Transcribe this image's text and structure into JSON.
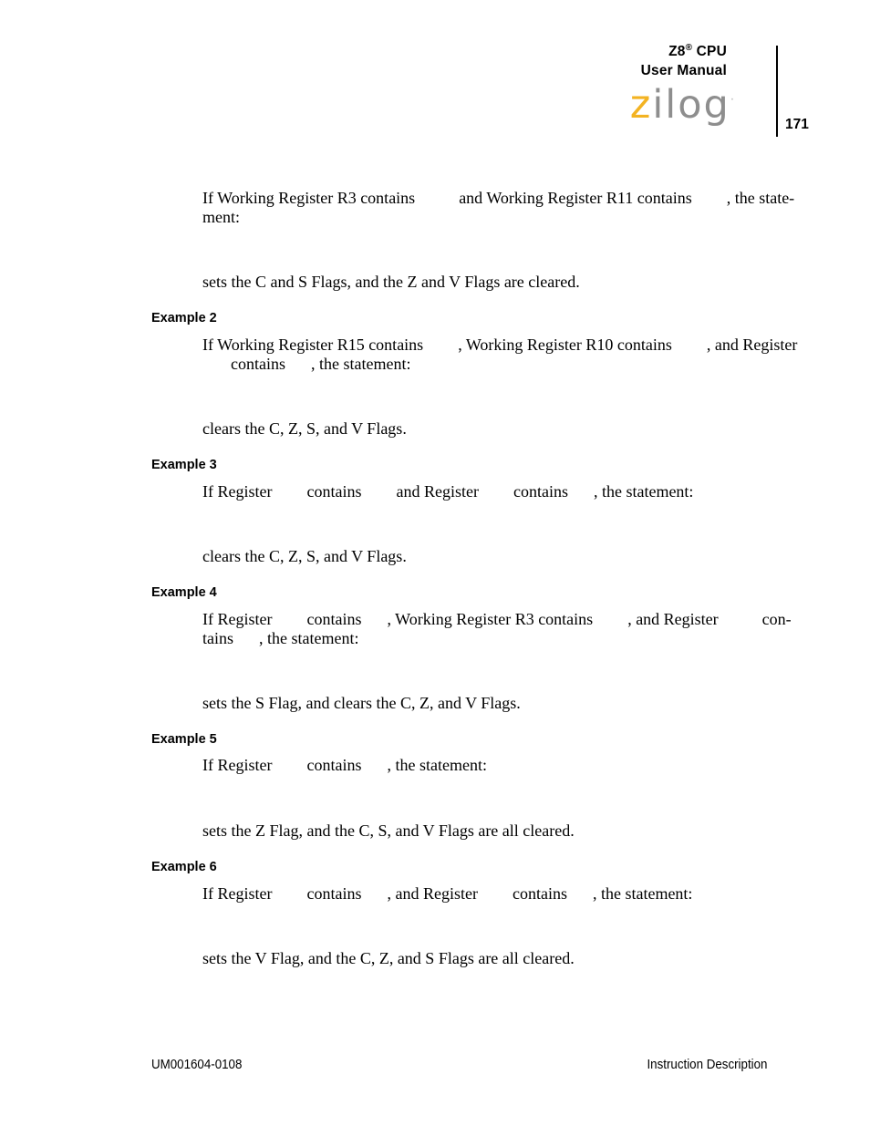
{
  "header": {
    "product_line1_main": "Z8",
    "product_line1_sup": "®",
    "product_line1_tail": " CPU",
    "product_line2": "User Manual",
    "logo_z": "z",
    "logo_ilog": "ilog",
    "logo_reg": "·",
    "page_number": "171",
    "accent_color": "#f3b322",
    "logo_gray": "#8e8e8e"
  },
  "body": {
    "example1": {
      "condition_line1_a": "If Working Register R3 contains",
      "condition_line1_b": "and Working Register R11 contains",
      "condition_line1_c": ", the state-",
      "condition_line2": "ment:",
      "statement": "",
      "result": "sets the C and S Flags, and the Z and V Flags are cleared."
    },
    "example2": {
      "heading": "Example 2",
      "condition_line1_a": "If Working Register R15 contains",
      "condition_line1_b": ", Working Register R10 contains",
      "condition_line1_c": ", and Register",
      "condition_line2_a": "contains",
      "condition_line2_b": ", the statement:",
      "statement": "",
      "result": "clears the C, Z, S, and V Flags."
    },
    "example3": {
      "heading": "Example 3",
      "condition_a": "If Register",
      "condition_b": "contains",
      "condition_c": "and Register",
      "condition_d": "contains",
      "condition_e": ", the statement:",
      "statement": "",
      "result": "clears the C, Z, S, and V Flags."
    },
    "example4": {
      "heading": "Example 4",
      "condition_line1_a": "If Register",
      "condition_line1_b": "contains",
      "condition_line1_c": ", Working Register R3 contains",
      "condition_line1_d": ", and Register",
      "condition_line1_e": "con-",
      "condition_line2_a": "tains",
      "condition_line2_b": ", the statement:",
      "statement": "",
      "result": "sets the S Flag, and clears the C, Z, and V Flags."
    },
    "example5": {
      "heading": "Example 5",
      "condition_a": "If Register",
      "condition_b": "contains",
      "condition_c": ", the statement:",
      "statement": "",
      "result": "sets the Z Flag, and the C, S, and V Flags are all cleared."
    },
    "example6": {
      "heading": "Example 6",
      "condition_a": "If Register",
      "condition_b": "contains",
      "condition_c": ", and Register",
      "condition_d": "contains",
      "condition_e": ", the statement:",
      "statement": "",
      "result": "sets the V Flag, and the C, Z, and S Flags are all cleared."
    }
  },
  "footer": {
    "document_id": "UM001604-0108",
    "section_name": "Instruction Description"
  }
}
